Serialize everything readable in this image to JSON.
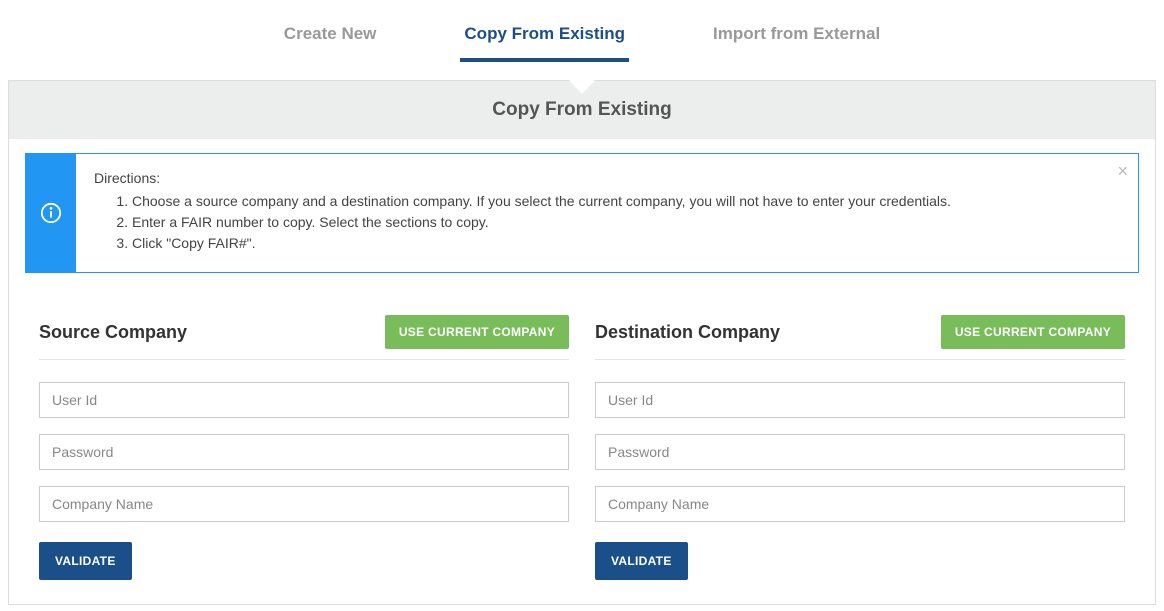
{
  "tabs": {
    "create": "Create New",
    "copy": "Copy From Existing",
    "import": "Import from External"
  },
  "panel": {
    "title": "Copy From Existing"
  },
  "alert": {
    "title": "Directions:",
    "step1": "Choose a source company and a destination company. If you select the current company, you will not have to enter your credentials.",
    "step2": "Enter a FAIR number to copy. Select the sections to copy.",
    "step3": "Click \"Copy FAIR#\"."
  },
  "source": {
    "title": "Source Company",
    "use_current": "Use Current Company",
    "user_ph": "User Id",
    "pass_ph": "Password",
    "company_ph": "Company Name",
    "validate": "Validate"
  },
  "dest": {
    "title": "Destination Company",
    "use_current": "Use Current Company",
    "user_ph": "User Id",
    "pass_ph": "Password",
    "company_ph": "Company Name",
    "validate": "Validate"
  }
}
